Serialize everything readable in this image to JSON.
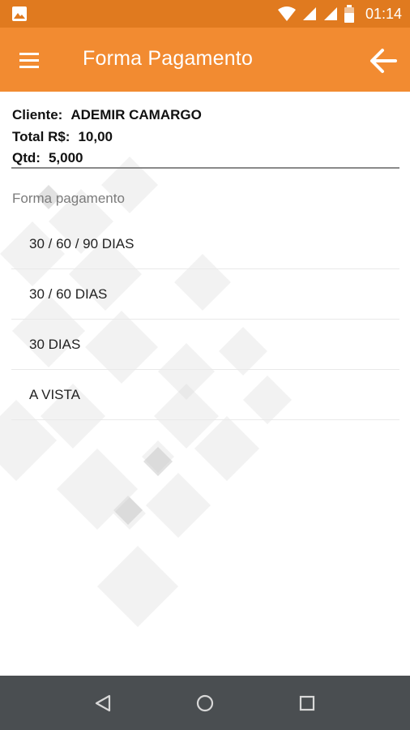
{
  "status_bar": {
    "time": "01:14",
    "icons": [
      "image-icon",
      "wifi-icon",
      "signal-icon",
      "signal-icon",
      "battery-icon"
    ]
  },
  "app_bar": {
    "title": "Forma Pagamento",
    "menu_icon": "hamburger-menu-icon",
    "back_icon": "arrow-back-icon",
    "color": "#f28b31"
  },
  "info": {
    "cliente_label": "Cliente:",
    "cliente_value": "ADEMIR CAMARGO",
    "total_label": "Total R$:",
    "total_value": "10,00",
    "qtd_label": "Qtd:",
    "qtd_value": "5,000"
  },
  "payment": {
    "section_label": "Forma pagamento",
    "options": [
      "30 / 60 / 90 DIAS",
      "30 / 60 DIAS",
      "30 DIAS",
      "A VISTA"
    ]
  },
  "nav_bar": {
    "icons": [
      "back-triangle-icon",
      "home-circle-icon",
      "recents-square-icon"
    ]
  }
}
